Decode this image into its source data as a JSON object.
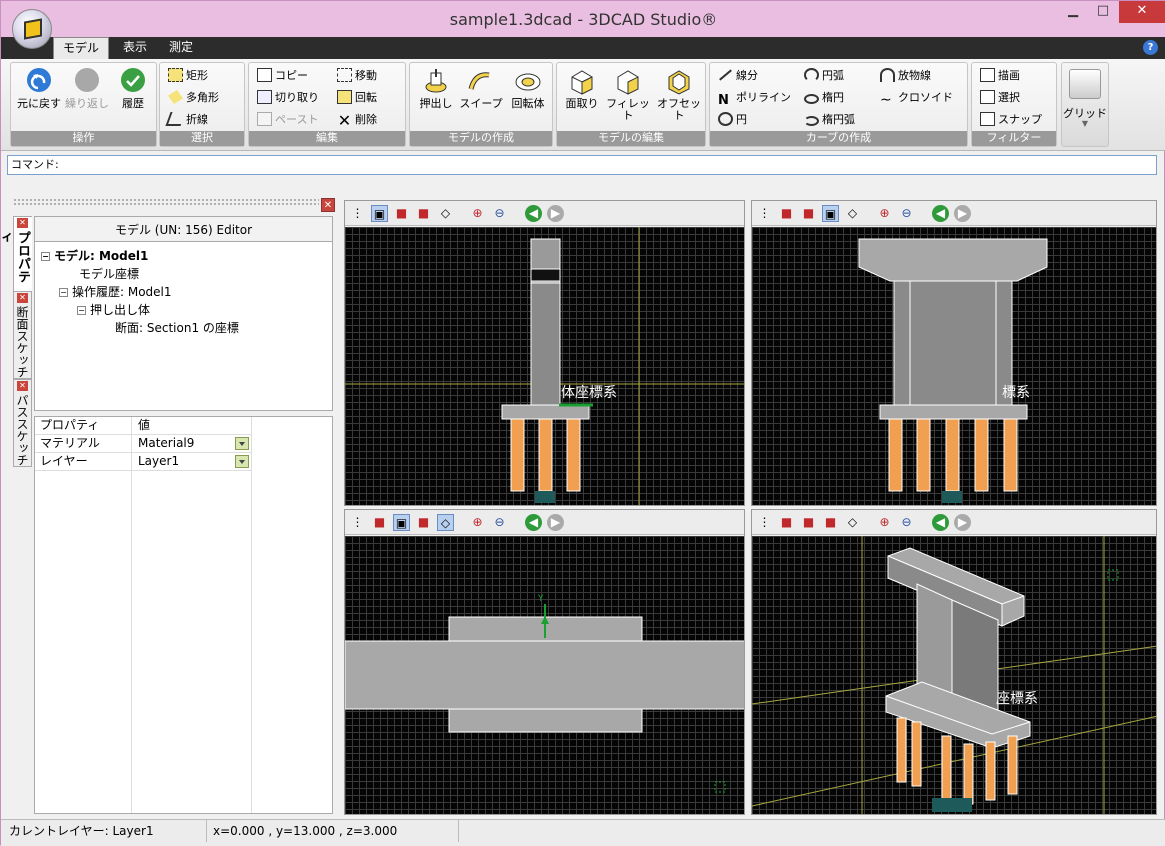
{
  "window": {
    "title": "sample1.3dcad - 3DCAD Studio®",
    "minimize": "▁",
    "maximize": "□",
    "close": "✕"
  },
  "tabs": [
    {
      "label": "モデル"
    },
    {
      "label": "表示"
    },
    {
      "label": "測定"
    }
  ],
  "ribbon": {
    "groups": {
      "operation": "操作",
      "select": "選択",
      "edit": "編集",
      "create_model": "モデルの作成",
      "edit_model": "モデルの編集",
      "create_curve": "カーブの作成",
      "filter": "フィルター"
    },
    "undo": "元に戻す",
    "redo": "繰り返し",
    "history": "履歴",
    "rect": "矩形",
    "polygon": "多角形",
    "polyline_sel": "折線",
    "copy": "コピー",
    "cut": "切り取り",
    "paste": "ペースト",
    "move": "移動",
    "rotate": "回転",
    "delete": "削除",
    "extrude": "押出し",
    "sweep": "スイープ",
    "revolve": "回転体",
    "chamfer": "面取り",
    "fillet": "フィレット",
    "offset": "オフセット",
    "line": "線分",
    "polyline": "ポリライン",
    "circle": "円",
    "arc": "円弧",
    "ellipse": "楕円",
    "ellipse_arc": "楕円弧",
    "parabola": "放物線",
    "clothoid": "クロソイド",
    "draw": "描画",
    "select": "選択",
    "snap": "スナップ",
    "grid": "グリッド"
  },
  "command": {
    "label": "コマンド:"
  },
  "side_tabs": [
    "プロパティ",
    "断面スケッチ",
    "パススケッチ"
  ],
  "editor": {
    "title": "モデル (UN: 156) Editor",
    "tree": [
      "モデル: Model1",
      "モデル座標",
      "操作履歴: Model1",
      "押し出し体",
      "断面: Section1 の座標"
    ]
  },
  "properties": {
    "header": [
      "プロパティ",
      "値"
    ],
    "rows": [
      {
        "name": "マテリアル",
        "value": "Material9"
      },
      {
        "name": "レイヤー",
        "value": "Layer1"
      }
    ]
  },
  "viewports": {
    "tl_label": "体座標系",
    "tr_label": "標系",
    "bl_axis": "Y",
    "br_label": "座標系"
  },
  "status": {
    "layer": "カレントレイヤー: Layer1",
    "coords": "x=0.000 , y=13.000 , z=3.000"
  },
  "colors": {
    "pile": "#f0a050",
    "accent": "#3a78d8",
    "close": "#c7393a"
  }
}
